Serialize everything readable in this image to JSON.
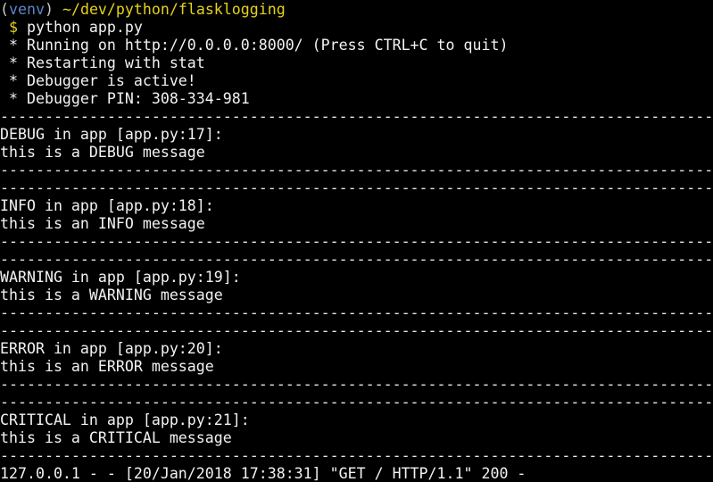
{
  "colors": {
    "background": "#000000",
    "text": "#f2f2f2",
    "venv": "#5b86c8",
    "path_and_prompt": "#e6d21a"
  },
  "prompt": {
    "venv_open": "(",
    "venv_name": "venv",
    "venv_close": ")",
    "path": "~/dev/python/flasklogging",
    "symbol": "$",
    "command": "python app.py"
  },
  "startup": [
    " * Running on http://0.0.0.0:8000/ (Press CTRL+C to quit)",
    " * Restarting with stat",
    " * Debugger is active!",
    " * Debugger PIN: 308-334-981"
  ],
  "separator": "--------------------------------------------------------------------------------",
  "log_entries": [
    {
      "header": "DEBUG in app [app.py:17]:",
      "message": "this is a DEBUG message"
    },
    {
      "header": "INFO in app [app.py:18]:",
      "message": "this is an INFO message"
    },
    {
      "header": "WARNING in app [app.py:19]:",
      "message": "this is a WARNING message"
    },
    {
      "header": "ERROR in app [app.py:20]:",
      "message": "this is an ERROR message"
    },
    {
      "header": "CRITICAL in app [app.py:21]:",
      "message": "this is a CRITICAL message"
    }
  ],
  "access_log": "127.0.0.1 - - [20/Jan/2018 17:38:31] \"GET / HTTP/1.1\" 200 -"
}
